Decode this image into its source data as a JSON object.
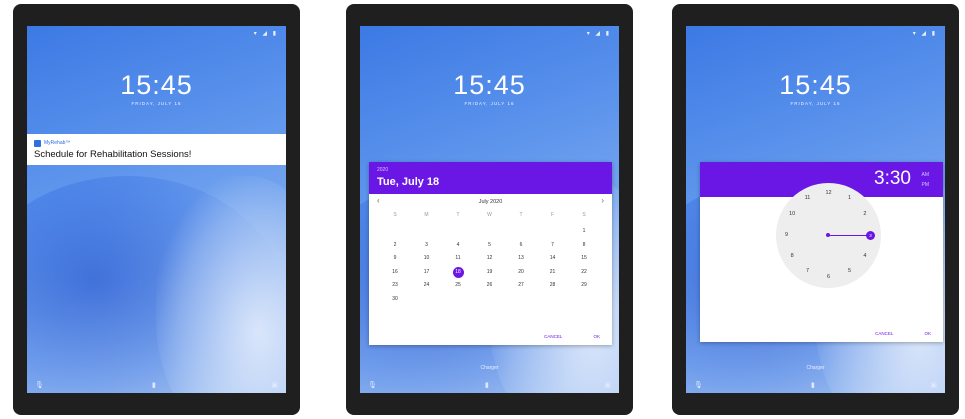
{
  "colors": {
    "accent": "#6a17e6",
    "wallpaper": "#3c79e4",
    "frame": "#1f1f1f"
  },
  "lockscreen": {
    "time": "15:45",
    "date": "FRIDAY, JULY 16",
    "owner": "Charger"
  },
  "notification": {
    "app_name": "MyRehab™",
    "message": "Schedule for Rehabilitation Sessions!"
  },
  "date_picker": {
    "year": "2020",
    "selected_date": "Tue, July 18",
    "month_label": "July 2020",
    "prev_icon": "chevron-left-icon",
    "next_icon": "chevron-right-icon",
    "weekdays": [
      "S",
      "M",
      "T",
      "W",
      "T",
      "F",
      "S"
    ],
    "weeks": [
      [
        "",
        "",
        "",
        "",
        "",
        "",
        "1"
      ],
      [
        "2",
        "3",
        "4",
        "5",
        "6",
        "7",
        "8"
      ],
      [
        "9",
        "10",
        "11",
        "12",
        "13",
        "14",
        "15"
      ],
      [
        "16",
        "17",
        "18",
        "19",
        "20",
        "21",
        "22"
      ],
      [
        "23",
        "24",
        "25",
        "26",
        "27",
        "28",
        "29"
      ],
      [
        "30",
        "",
        "",
        "",
        "",
        "",
        ""
      ]
    ],
    "selected_day": "18",
    "cancel_label": "CANCEL",
    "ok_label": "OK"
  },
  "time_picker": {
    "time": "3:30",
    "am_label": "AM",
    "pm_label": "PM",
    "selected_hour": "3",
    "hours": [
      "12",
      "1",
      "2",
      "3",
      "4",
      "5",
      "6",
      "7",
      "8",
      "9",
      "10",
      "11"
    ],
    "cancel_label": "CANCEL",
    "ok_label": "OK"
  }
}
